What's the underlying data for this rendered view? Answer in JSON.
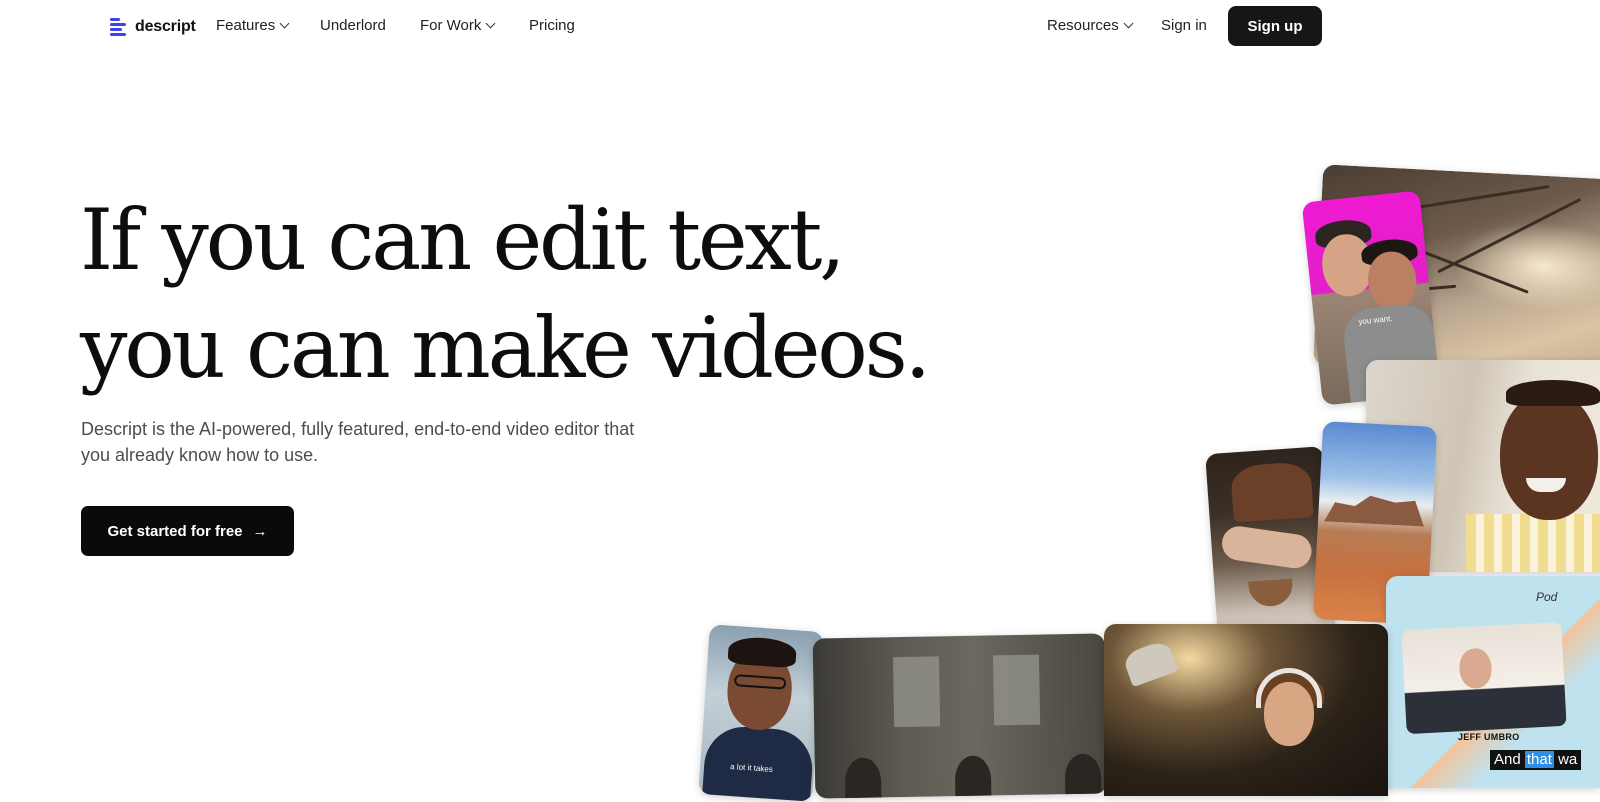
{
  "nav": {
    "logo_text": "descript",
    "features": "Features",
    "underlord": "Underlord",
    "for_work": "For Work",
    "pricing": "Pricing",
    "resources": "Resources",
    "sign_in": "Sign in",
    "sign_up": "Sign up"
  },
  "hero": {
    "headline_line1": "If you can edit text,",
    "headline_line2": "you can make videos.",
    "subtitle": "Descript is the AI-powered, fully featured, end-to-end video editor that you already know how to use.",
    "cta_label": "Get started for free",
    "cta_arrow": "→"
  },
  "collage": {
    "pink_caption": "you want.",
    "guy_caption": "a lot it takes",
    "podcast_brand": "Pod",
    "podcast_name": "JEFF UMBRO",
    "caption_and": "And",
    "caption_that": "that",
    "caption_wa": "wa"
  },
  "colors": {
    "brand": "#3f42e8",
    "button_bg": "#161616",
    "caption_highlight": "#2f8ee8"
  }
}
